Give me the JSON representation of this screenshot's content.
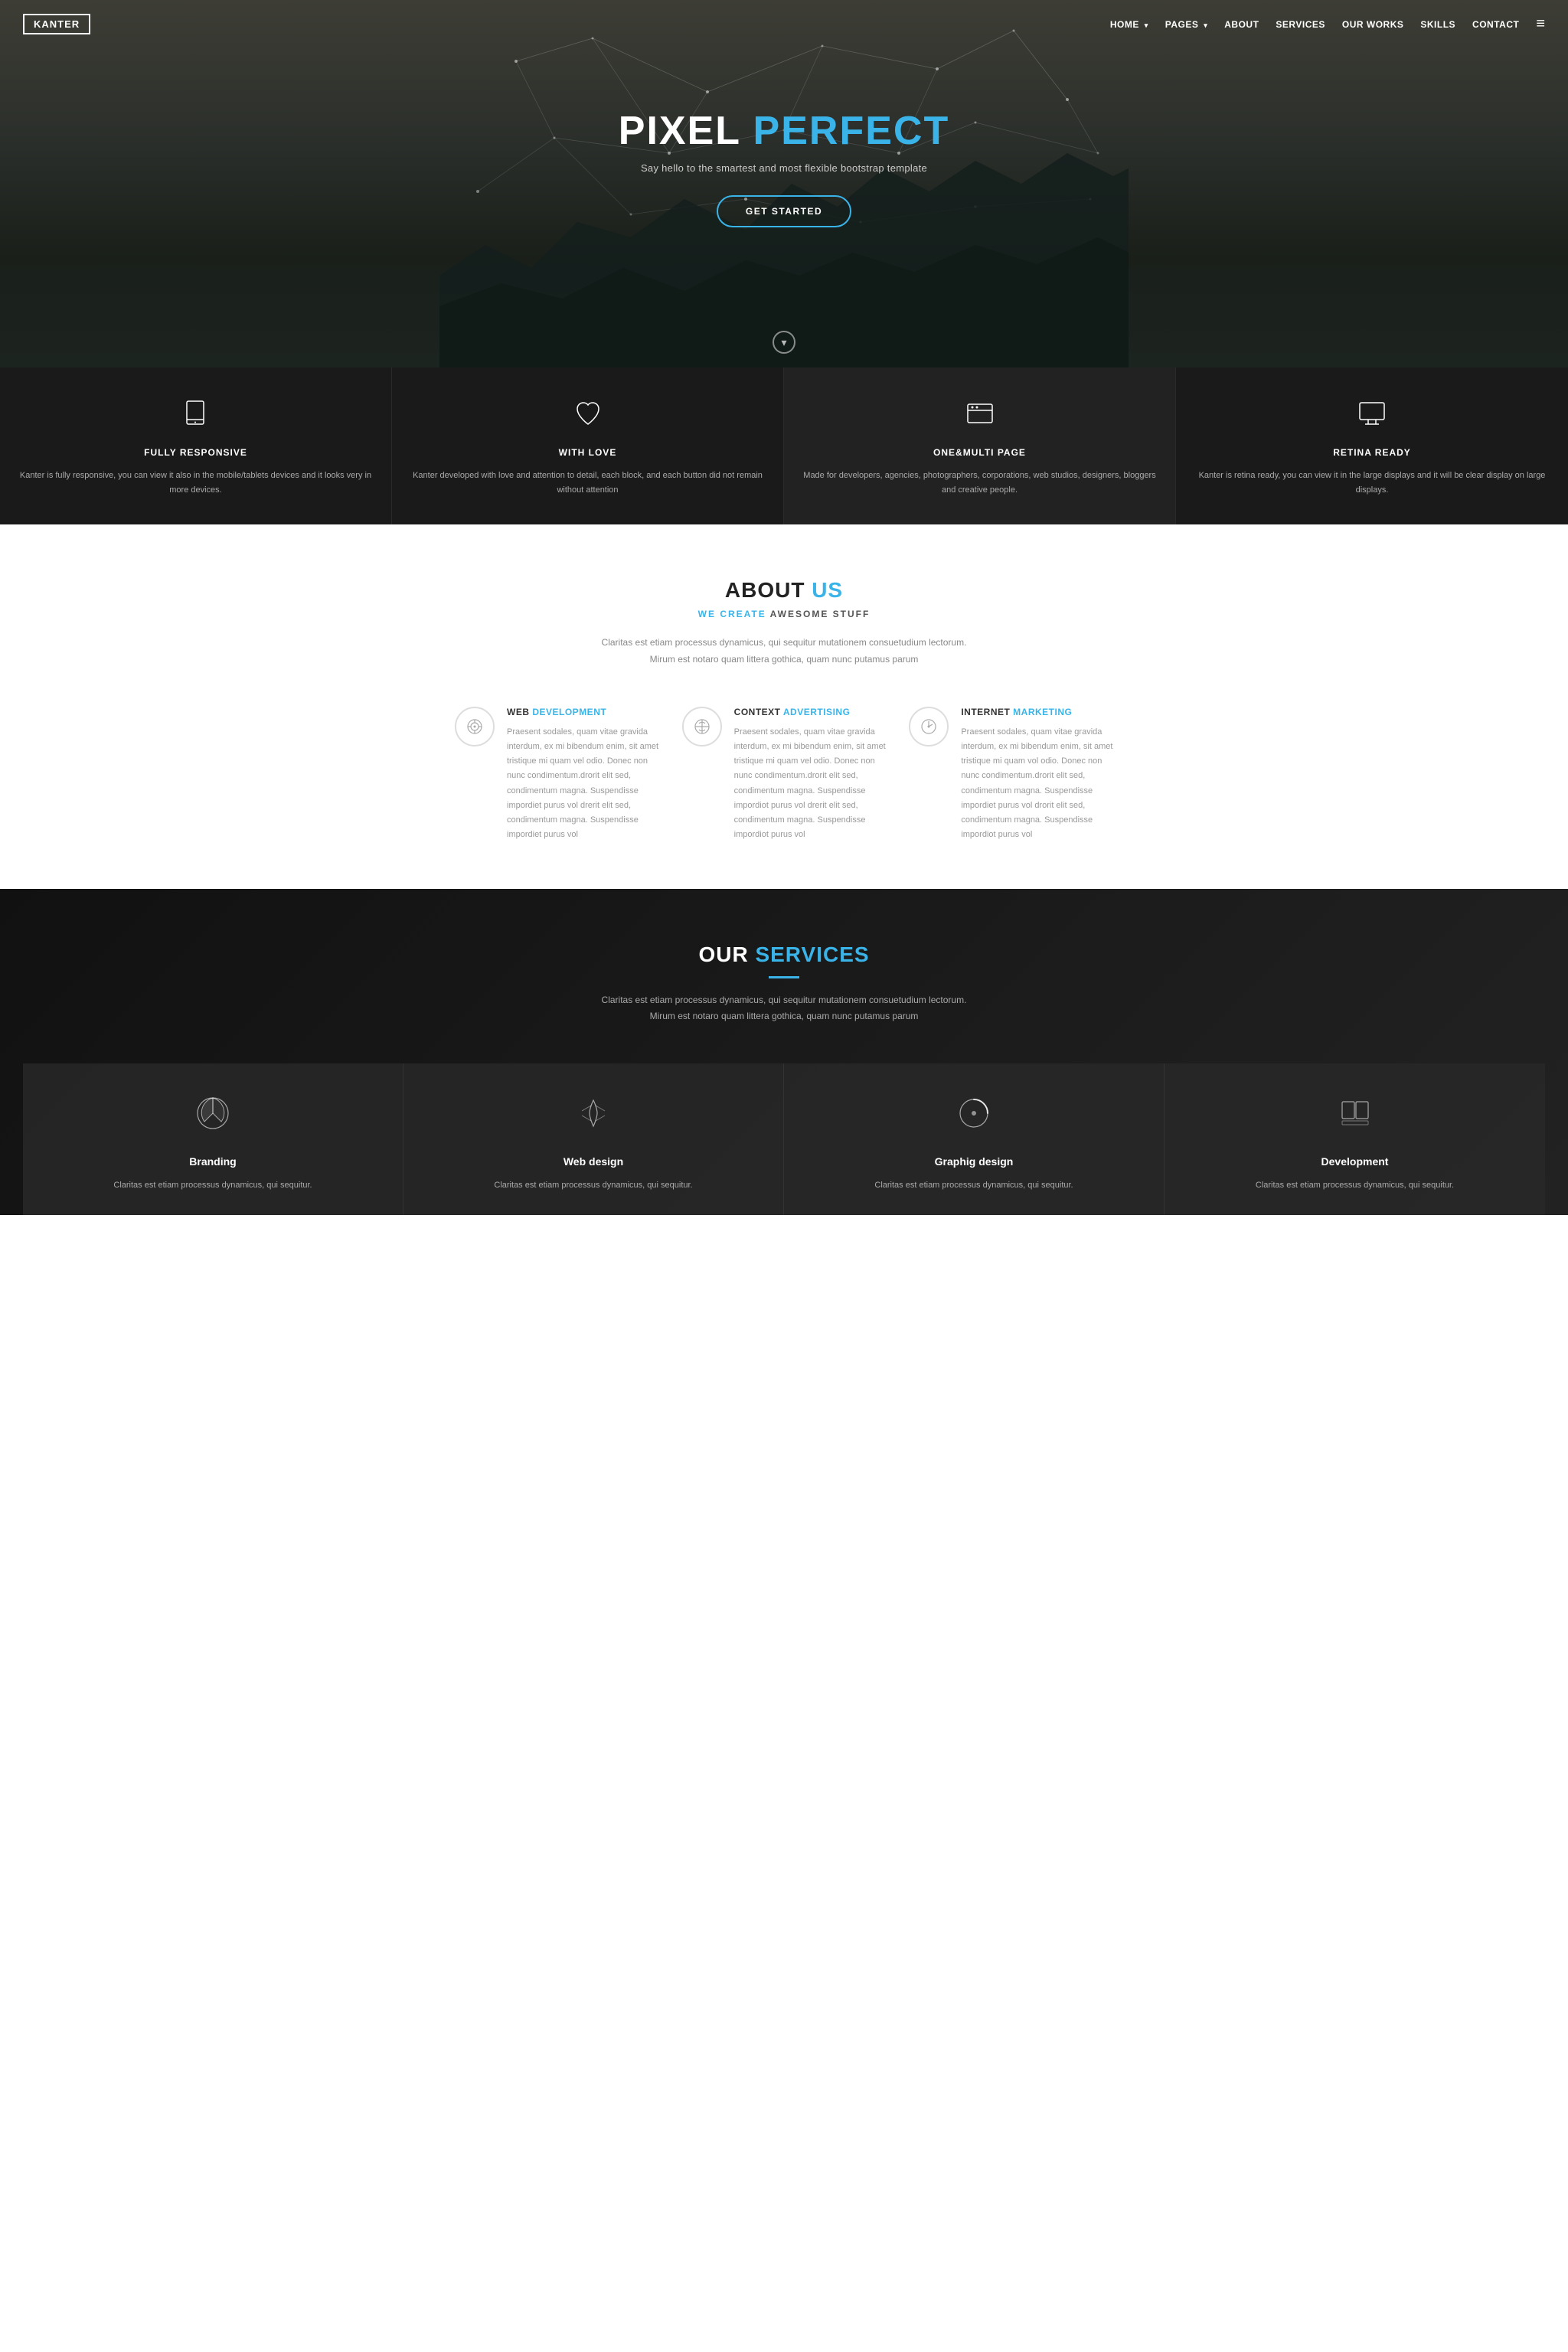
{
  "brand": {
    "logo": "KANTER"
  },
  "navbar": {
    "links": [
      {
        "label": "HOME",
        "has_dropdown": true,
        "active": false
      },
      {
        "label": "PAGES",
        "has_dropdown": true,
        "active": false
      },
      {
        "label": "ABOUT",
        "has_dropdown": false,
        "active": false
      },
      {
        "label": "SERVICES",
        "has_dropdown": false,
        "active": false
      },
      {
        "label": "OUR WORKS",
        "has_dropdown": false,
        "active": false
      },
      {
        "label": "SKILLS",
        "has_dropdown": false,
        "active": false
      },
      {
        "label": "CONTACT",
        "has_dropdown": false,
        "active": false
      }
    ]
  },
  "hero": {
    "title_part1": "PIXEL ",
    "title_part2": "PERFECT",
    "subtitle": "Say hello to the smartest and most flexible bootstrap template",
    "cta_label": "GET STARTED"
  },
  "features": [
    {
      "icon": "📱",
      "title": "FULLY RESPONSIVE",
      "desc": "Kanter is fully responsive, you can view it also in the mobile/tablets devices and it looks very in more devices."
    },
    {
      "icon": "♡",
      "title": "WITH LOVE",
      "desc": "Kanter developed with love and attention to detail, each block, and each button did not remain without attention"
    },
    {
      "icon": "⬜",
      "title": "ONE&MULTI PAGE",
      "desc": "Made for developers, agencies, photographers, corporations, web studios, designers, bloggers and creative people."
    },
    {
      "icon": "🖥",
      "title": "RETINA READY",
      "desc": "Kanter is retina ready, you can view it in the large displays and it will be clear display on large displays."
    }
  ],
  "about": {
    "title_part1": "ABOUT ",
    "title_part2": "US",
    "subtitle_part1": "WE CREATE ",
    "subtitle_part2": "AWESOME STUFF",
    "desc": "Claritas est etiam processus dynamicus, qui sequitur mutationem consuetudium lectorum. Mirum est notaro quam littera gothica, quam nunc putamus parum",
    "features": [
      {
        "title_part1": "WEB ",
        "title_part2": "DEVELOPMENT",
        "desc": "Praesent sodales, quam vitae gravida interdum, ex mi bibendum enim, sit amet tristique mi quam vel odio. Donec non nunc condimentum.drorit elit sed, condimentum magna. Suspendisse impordiet purus vol drerit elit sed, condimentum magna. Suspendisse impordiet purus vol"
      },
      {
        "title_part1": "CONTEXT ",
        "title_part2": "ADVERTISING",
        "desc": "Praesent sodales, quam vitae gravida interdum, ex mi bibendum enim, sit amet tristique mi quam vel odio. Donec non nunc condimentum.drorit elit sed, condimentum magna. Suspendisse impordiot purus vol drerit elit sed, condimentum magna. Suspendisse impordiot purus vol"
      },
      {
        "title_part1": "INTERNET ",
        "title_part2": "MARKETING",
        "desc": "Praesent sodales, quam vitae gravida interdum, ex mi bibendum enim, sit amet tristique mi quam vol odio. Donec non nunc condimentum.drorit elit sed, condimentum magna. Suspendisse impordiet purus vol drorit elit sed, condimentum magna. Suspendisse impordiot purus vol"
      }
    ]
  },
  "services": {
    "title_part1": "OUR ",
    "title_part2": "SERVICES",
    "desc": "Claritas est etiam processus dynamicus, qui sequitur mutationem consuetudium lectorum. Mirum est notaro quam littera gothica, quam nunc putamus parum",
    "cards": [
      {
        "title": "Branding",
        "desc": "Claritas est etiam processus dynamicus, qui sequitur."
      },
      {
        "title": "Web design",
        "desc": "Claritas est etiam processus dynamicus, qui sequitur."
      },
      {
        "title": "Graphig design",
        "desc": "Claritas est etiam processus dynamicus, qui sequitur."
      },
      {
        "title": "Development",
        "desc": "Claritas est etiam processus dynamicus, qui sequitur."
      }
    ]
  },
  "colors": {
    "accent": "#3ab4e8",
    "dark_bg": "#1a1a1a",
    "light_bg": "#ffffff"
  }
}
